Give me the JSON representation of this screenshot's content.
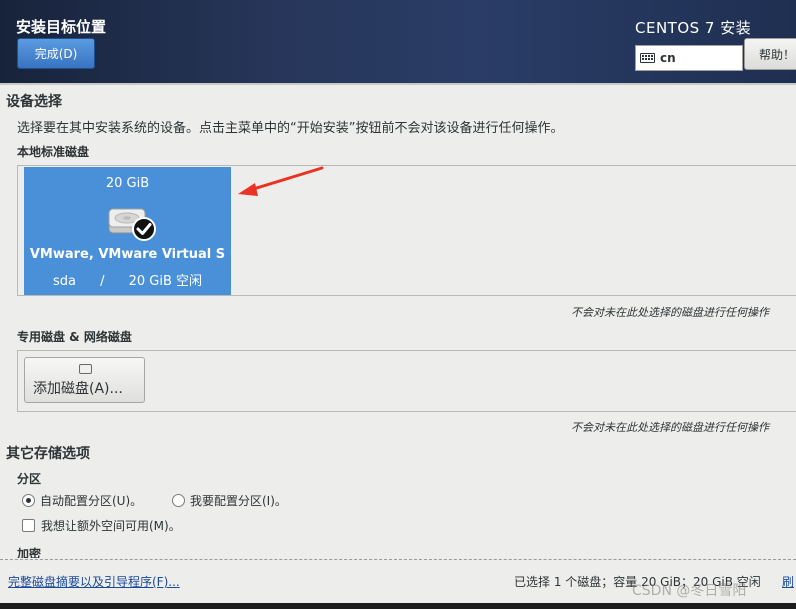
{
  "header": {
    "title": "安装目标位置",
    "done_button": "完成(D)",
    "product": "CENTOS 7 安装",
    "keyboard_layout": "cn",
    "help_button": "帮助！"
  },
  "device_selection": {
    "heading": "设备选择",
    "description": "选择要在其中安装系统的设备。点击主菜单中的“开始安装”按钮前不会对该设备进行任何操作。",
    "local_disks_label": "本地标准磁盘",
    "disk": {
      "size": "20 GiB",
      "name": "VMware, VMware Virtual S",
      "device": "sda",
      "separator": "/",
      "free": "20 GiB 空闲",
      "selected": true
    },
    "local_note": "不会对未在此处选择的磁盘进行任何操作",
    "specialized_label": "专用磁盘 & 网络磁盘",
    "add_disk_button": "添加磁盘(A)...",
    "specialized_note": "不会对未在此处选择的磁盘进行任何操作"
  },
  "other_storage": {
    "heading": "其它存储选项",
    "partition_label": "分区",
    "auto_partition": "自动配置分区(U)。",
    "manual_partition": "我要配置分区(I)。",
    "auto_selected": true,
    "extra_space": "我想让额外空间可用(M)。",
    "encryption_label": "加密"
  },
  "footer": {
    "summary_link": "完整磁盘摘要以及引导程序(F)...",
    "status": "已选择 1 个磁盘；容量 20 GiB；20 GiB 空闲",
    "refresh_link": "刷"
  },
  "watermark": "CSDN @冬日雪阳",
  "colors": {
    "header_bg": "#27365a",
    "selected_disk": "#4a90d9",
    "accent_button": "#3874c2",
    "annotation_arrow": "#ea3323"
  }
}
